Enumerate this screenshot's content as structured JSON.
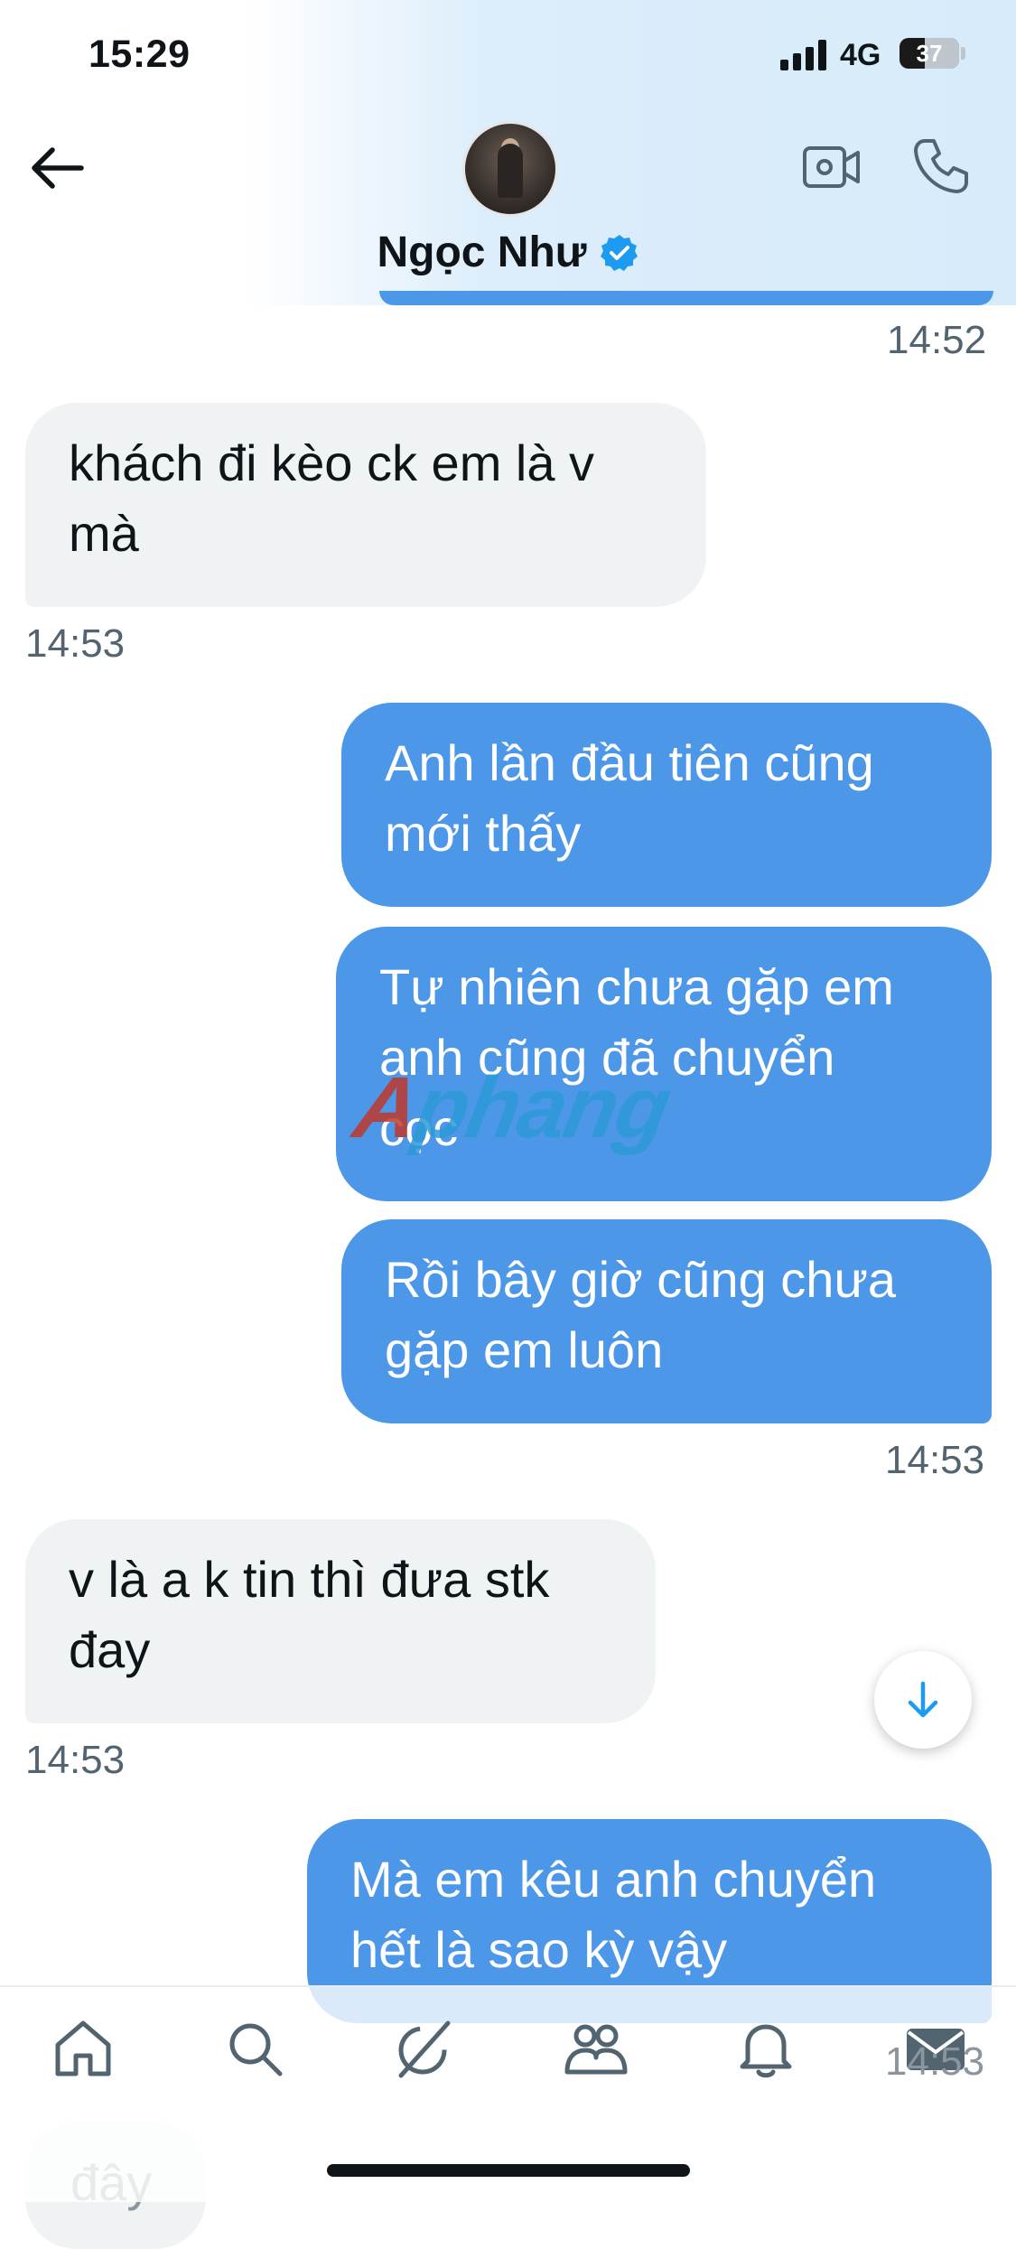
{
  "status_bar": {
    "time": "15:29",
    "network": "4G",
    "battery": "37"
  },
  "header": {
    "contact_name": "Ngọc Như"
  },
  "messages": [
    {
      "timestamp": "14:52"
    },
    {
      "text": "khách đi kèo ck em là v\nmà",
      "timestamp": "14:53"
    },
    {
      "text": "Anh lần đầu tiên cũng\nmới thấy"
    },
    {
      "text": "Tự nhiên chưa gặp em\nanh cũng đã chuyển\ncọc"
    },
    {
      "text": "Rồi bây giờ cũng chưa\ngặp em luôn",
      "timestamp": "14:53"
    },
    {
      "text": "v là a k tin thì đưa stk\nđay",
      "timestamp": "14:53"
    },
    {
      "text": "Mà em kêu anh chuyển\nhết là sao kỳ vậy",
      "timestamp": "14:53"
    },
    {
      "text": "đây"
    }
  ],
  "watermark": {
    "part1": "A",
    "part2": "phang"
  },
  "tab_bar": {
    "items": [
      "home-icon",
      "search-icon",
      "grok-icon",
      "communities-icon",
      "notifications-icon",
      "messages-icon"
    ]
  },
  "colors": {
    "outgoing_bubble": "#4c97e8",
    "incoming_bubble": "#eff3f4",
    "verified": "#1d9bf0"
  }
}
